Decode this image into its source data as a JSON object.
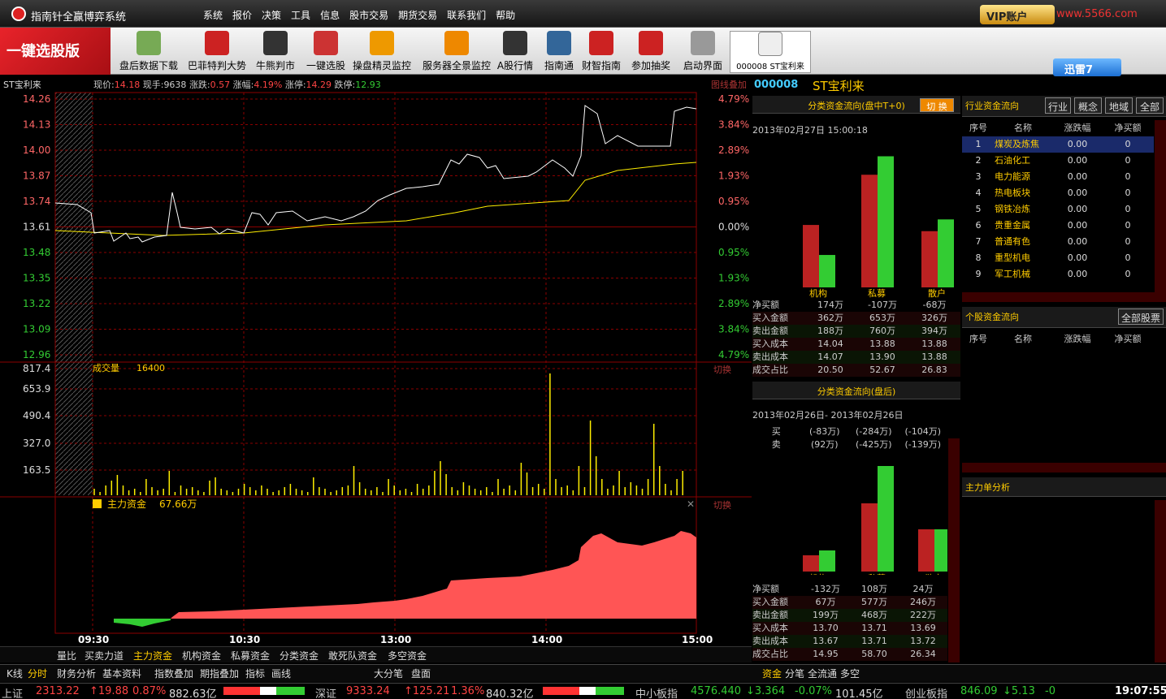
{
  "title": "指南针全赢博弈系统",
  "menu": [
    "系统",
    "报价",
    "决策",
    "工具",
    "信息",
    "股市交易",
    "期货交易",
    "联系我们",
    "帮助"
  ],
  "vip_label": "VIP账户",
  "watermark": "www.5566.com",
  "banner": "一键选股版",
  "toolbar": [
    {
      "label": "盘后数据下载",
      "icon": "download-icon",
      "color": "#7a5"
    },
    {
      "label": "巴菲特判大势",
      "icon": "buffett-icon",
      "color": "#c22"
    },
    {
      "label": "牛熊判市",
      "icon": "bull-bear-icon",
      "color": "#333"
    },
    {
      "label": "一键选股",
      "icon": "chart-up-icon",
      "color": "#c33"
    },
    {
      "label": "操盘精灵监控",
      "icon": "wizard-icon",
      "color": "#e90"
    },
    {
      "label": "服务器全景监控",
      "icon": "server-icon",
      "color": "#e80"
    },
    {
      "label": "A股行情",
      "icon": "a-share-icon",
      "color": "#333"
    },
    {
      "label": "指南通",
      "icon": "compass-icon",
      "color": "#369"
    },
    {
      "label": "财智指南",
      "icon": "wealth-icon",
      "color": "#c22"
    },
    {
      "label": "参加抽奖",
      "icon": "lottery-icon",
      "color": "#c22"
    },
    {
      "label": "启动界面",
      "icon": "launch-icon",
      "color": "#999"
    }
  ],
  "toolbar_active": "000008  ST宝利来",
  "xunlei": "迅雷7",
  "stock": {
    "name": "ST宝利来",
    "code": "000008",
    "quote": {
      "price_label": "现价:",
      "price": "14.18",
      "vol_label": "现手:",
      "vol": "9638",
      "chg_label": "涨跌:",
      "chg": "0.57",
      "pct_label": "涨幅:",
      "pct": "4.19%",
      "up_label": "涨停:",
      "up": "14.29",
      "down_label": "跌停:",
      "down": "12.93"
    },
    "overlay_label": "图线叠加"
  },
  "price_axis": [
    "14.26",
    "14.13",
    "14.00",
    "13.87",
    "13.74",
    "13.61",
    "13.48",
    "13.35",
    "13.22",
    "13.09",
    "12.96"
  ],
  "pct_axis": [
    "4.79%",
    "3.84%",
    "2.89%",
    "1.93%",
    "0.95%",
    "0.00%",
    "0.95%",
    "1.93%",
    "2.89%",
    "3.84%",
    "4.79%"
  ],
  "volume": {
    "label": "成交量",
    "value": "16400",
    "switch": "切换",
    "axis": [
      "817.4",
      "653.9",
      "490.4",
      "327.0",
      "163.5"
    ]
  },
  "mainforce": {
    "label": "主力资金",
    "value": "67.66万",
    "switch": "切换"
  },
  "time_axis": [
    "09:30",
    "10:30",
    "13:00",
    "14:00",
    "15:00"
  ],
  "chart_data": {
    "type": "line",
    "title": "",
    "x": [
      "09:30",
      "10:30",
      "13:00",
      "14:00",
      "15:00"
    ],
    "series": [],
    "ylim": [
      12.96,
      14.26
    ]
  },
  "flow_intraday": {
    "title": "分类资金流向(盘中T+0)",
    "switch": "切 换",
    "date": "2013年02月27日 15:00:18",
    "groups": [
      "机构",
      "私募",
      "散户"
    ],
    "rows": [
      {
        "label": "净买额",
        "vals": [
          "174万",
          "-107万",
          "-68万"
        ]
      },
      {
        "label": "买入金额",
        "vals": [
          "362万",
          "653万",
          "326万"
        ]
      },
      {
        "label": "卖出金额",
        "vals": [
          "188万",
          "760万",
          "394万"
        ]
      },
      {
        "label": "买入成本",
        "vals": [
          "14.04",
          "13.88",
          "13.88"
        ]
      },
      {
        "label": "卖出成本",
        "vals": [
          "14.07",
          "13.90",
          "13.88"
        ]
      },
      {
        "label": "成交占比",
        "vals": [
          "20.50",
          "52.67",
          "26.83"
        ]
      }
    ],
    "buy": [
      362,
      653,
      326
    ],
    "sell": [
      188,
      760,
      394
    ]
  },
  "flow_after": {
    "title": "分类资金流向(盘后)",
    "date": "2013年02月26日- 2013年02月26日",
    "buy_label": "买",
    "sell_label": "卖",
    "buy_vals": [
      "(-83万)",
      "(-284万)",
      "(-104万)"
    ],
    "sell_vals": [
      "(92万)",
      "(-425万)",
      "(-139万)"
    ],
    "groups": [
      "机构",
      "私募",
      "散户"
    ],
    "rows": [
      {
        "label": "净买额",
        "vals": [
          "-132万",
          "108万",
          "24万"
        ]
      },
      {
        "label": "买入金额",
        "vals": [
          "67万",
          "577万",
          "246万"
        ]
      },
      {
        "label": "卖出金额",
        "vals": [
          "199万",
          "468万",
          "222万"
        ]
      },
      {
        "label": "买入成本",
        "vals": [
          "13.70",
          "13.71",
          "13.69"
        ]
      },
      {
        "label": "卖出成本",
        "vals": [
          "13.67",
          "13.71",
          "13.72"
        ]
      },
      {
        "label": "成交占比",
        "vals": [
          "14.95",
          "58.70",
          "26.34"
        ]
      }
    ]
  },
  "industry": {
    "title": "行业资金流向",
    "buttons": [
      "行业",
      "概念",
      "地域",
      "全部"
    ],
    "headers": [
      "序号",
      "名称",
      "涨跌幅",
      "净买额"
    ],
    "rows": [
      {
        "n": "1",
        "name": "煤炭及炼焦",
        "chg": "0.00",
        "net": "0"
      },
      {
        "n": "2",
        "name": "石油化工",
        "chg": "0.00",
        "net": "0"
      },
      {
        "n": "3",
        "name": "电力能源",
        "chg": "0.00",
        "net": "0"
      },
      {
        "n": "4",
        "name": "热电板块",
        "chg": "0.00",
        "net": "0"
      },
      {
        "n": "5",
        "name": "钢铁冶炼",
        "chg": "0.00",
        "net": "0"
      },
      {
        "n": "6",
        "name": "贵重金属",
        "chg": "0.00",
        "net": "0"
      },
      {
        "n": "7",
        "name": "普通有色",
        "chg": "0.00",
        "net": "0"
      },
      {
        "n": "8",
        "name": "重型机电",
        "chg": "0.00",
        "net": "0"
      },
      {
        "n": "9",
        "name": "军工机械",
        "chg": "0.00",
        "net": "0"
      }
    ]
  },
  "stockflow": {
    "title": "个股资金流向",
    "button": "全部股票",
    "headers": [
      "序号",
      "名称",
      "涨跌幅",
      "净买额"
    ]
  },
  "mainorder": {
    "title": "主力单分析"
  },
  "tabs1": [
    "量比",
    "买卖力道",
    "主力资金",
    "机构资金",
    "私募资金",
    "分类资金",
    "敢死队资金",
    "多空资金"
  ],
  "tabs1_active": "主力资金",
  "tabs2": [
    "K线",
    "分时",
    "财务分析",
    "基本资料",
    "指数叠加",
    "期指叠加",
    "指标",
    "画线",
    "大分笔",
    "盘面"
  ],
  "tabs2_active": "分时",
  "tabs3": [
    "资金",
    "分笔",
    "全流通",
    "多空"
  ],
  "tabs3_active": "资金",
  "status": {
    "sh": {
      "name": "上证",
      "idx": "2313.22",
      "chg": "↑19.88",
      "pct": "0.87%",
      "amt": "882.63亿"
    },
    "sz": {
      "name": "深证",
      "idx": "9333.24",
      "chg": "↑125.21",
      "pct": "1.36%",
      "amt": "840.32亿"
    },
    "zx": {
      "name": "中小板指",
      "idx": "4576.440",
      "chg": "↓3.364",
      "pct": "-0.07%",
      "amt": "101.45亿"
    },
    "cy": {
      "name": "创业板指",
      "idx": "846.09",
      "chg": "↓5.13",
      "pct": "-0"
    },
    "time": "19:07:55"
  },
  "colors": {
    "up": "#ff4444",
    "down": "#33cc33",
    "accent": "#ffcc00",
    "grid": "#8b0000",
    "price": "#ffffff",
    "avg": "#ffee00"
  }
}
